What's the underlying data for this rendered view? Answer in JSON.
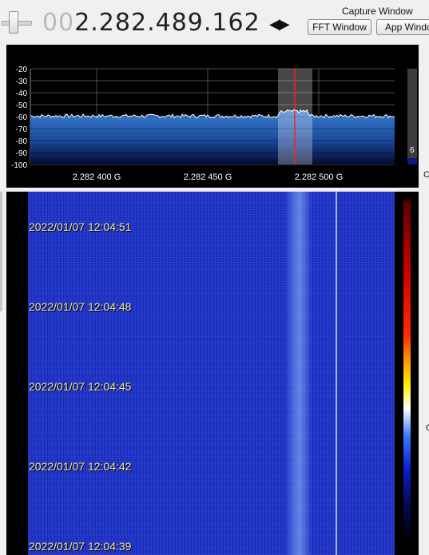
{
  "header": {
    "frequency_lead": "00",
    "frequency_main": "2.282.489.162",
    "tuning_arrows": "◀▶",
    "capture_label": "Capture Window",
    "fft_window_button": "FFT Window",
    "app_window_button": "App Windo"
  },
  "spectrum": {
    "y_ticks": [
      "-20",
      "-30",
      "-40",
      "-50",
      "-60",
      "-70",
      "-80",
      "-90",
      "-100"
    ],
    "x_ticks": [
      "2.282 400 G",
      "2.282 450 G",
      "2.282 500 G"
    ],
    "signal_level": "6",
    "colors": {
      "fill_top": "#3a7fd0",
      "fill_bottom": "#040a30",
      "trace": "#ffffff",
      "marker": "#ff2020"
    }
  },
  "waterfall": {
    "timestamps": [
      "2022/01/07 12:04:51",
      "2022/01/07 12:04:48",
      "2022/01/07 12:04:45",
      "2022/01/07 12:04:42",
      "2022/01/07 12:04:39"
    ]
  },
  "edge": {
    "c1": "C",
    "c2": "C"
  }
}
